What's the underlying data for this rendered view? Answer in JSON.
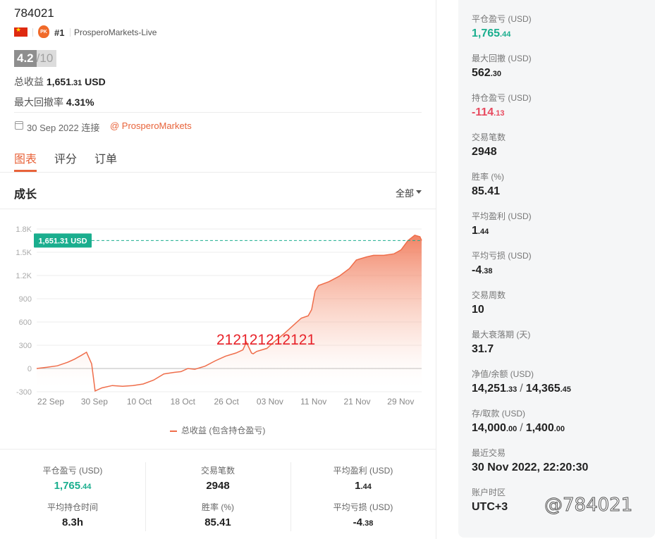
{
  "header": {
    "account_id": "784021",
    "rank": "#1",
    "broker": "ProsperoMarkets-Live",
    "badge_text": "PK",
    "score": "4.2",
    "score_max": "/10",
    "total_profit_label": "总收益",
    "total_profit_int": "1,651",
    "total_profit_dec": ".31",
    "total_profit_ccy": "USD",
    "max_drawdown_label": "最大回撤率",
    "max_drawdown_value": "4.31%",
    "joined_text": "30 Sep 2022 连接",
    "broker_link": "@ ProsperoMarkets"
  },
  "tabs": [
    {
      "label": "图表",
      "active": true
    },
    {
      "label": "评分",
      "active": false
    },
    {
      "label": "订单",
      "active": false
    }
  ],
  "growth": {
    "title": "成长",
    "range_label": "全部",
    "legend_label": "总收益 (包含持仓盈亏)",
    "overlay_text": "212121212121",
    "current_value_label": "1,651.31 USD"
  },
  "chart_data": {
    "type": "area",
    "title": "",
    "xlabel": "",
    "ylabel": "",
    "ylim": [
      -300,
      1800
    ],
    "yticks": [
      -300,
      0,
      300,
      600,
      900,
      1200,
      1500,
      1800
    ],
    "ytick_labels": [
      "-300",
      "0",
      "300",
      "600",
      "900",
      "1.2K",
      "1.5K",
      "1.8K"
    ],
    "x_tick_labels": [
      "22 Sep",
      "30 Sep",
      "10 Oct",
      "18 Oct",
      "26 Oct",
      "03 Nov",
      "11 Nov",
      "21 Nov",
      "29 Nov"
    ],
    "x_tick_pos": [
      0.115,
      0.215,
      0.318,
      0.418,
      0.518,
      0.618,
      0.718,
      0.818,
      0.918
    ],
    "series": [
      {
        "name": "",
        "color": "#ef6d4a",
        "points": [
          [
            0.0,
            0
          ],
          [
            0.03,
            15
          ],
          [
            0.06,
            35
          ],
          [
            0.09,
            80
          ],
          [
            0.11,
            120
          ],
          [
            0.13,
            170
          ],
          [
            0.145,
            210
          ],
          [
            0.16,
            60
          ],
          [
            0.17,
            -290
          ],
          [
            0.19,
            -250
          ],
          [
            0.22,
            -220
          ],
          [
            0.25,
            -230
          ],
          [
            0.28,
            -220
          ],
          [
            0.31,
            -200
          ],
          [
            0.34,
            -150
          ],
          [
            0.37,
            -70
          ],
          [
            0.4,
            -50
          ],
          [
            0.42,
            -40
          ],
          [
            0.44,
            0
          ],
          [
            0.46,
            -10
          ],
          [
            0.49,
            30
          ],
          [
            0.52,
            100
          ],
          [
            0.55,
            160
          ],
          [
            0.58,
            200
          ],
          [
            0.6,
            240
          ],
          [
            0.61,
            340
          ],
          [
            0.625,
            200
          ],
          [
            0.63,
            190
          ],
          [
            0.64,
            220
          ],
          [
            0.67,
            260
          ],
          [
            0.69,
            340
          ],
          [
            0.72,
            450
          ],
          [
            0.75,
            570
          ],
          [
            0.77,
            650
          ],
          [
            0.79,
            680
          ],
          [
            0.8,
            760
          ],
          [
            0.81,
            1000
          ],
          [
            0.82,
            1070
          ],
          [
            0.85,
            1120
          ],
          [
            0.88,
            1190
          ],
          [
            0.91,
            1290
          ],
          [
            0.93,
            1400
          ],
          [
            0.96,
            1440
          ],
          [
            0.98,
            1460
          ],
          [
            1.01,
            1460
          ],
          [
            1.04,
            1480
          ],
          [
            1.06,
            1530
          ],
          [
            1.08,
            1650
          ],
          [
            1.1,
            1720
          ],
          [
            1.115,
            1700
          ],
          [
            1.12,
            1651
          ]
        ]
      }
    ],
    "current_value": 1651.31,
    "grid": true,
    "legend_position": "bottom-center"
  },
  "bottom_stats": [
    {
      "label": "平仓盈亏 (USD)",
      "int": "1,765",
      "dec": ".44",
      "color": "green"
    },
    {
      "label": "交易笔数",
      "int": "2948",
      "dec": "",
      "color": ""
    },
    {
      "label": "平均盈利 (USD)",
      "int": "1",
      "dec": ".44",
      "color": ""
    },
    {
      "label": "平均持仓时间",
      "int": "8.3h",
      "dec": "",
      "color": ""
    },
    {
      "label": "胜率 (%)",
      "int": "85.41",
      "dec": "",
      "color": ""
    },
    {
      "label": "平均亏损 (USD)",
      "int": "-4",
      "dec": ".38",
      "color": ""
    }
  ],
  "right_panel": [
    {
      "label": "平仓盈亏 (USD)",
      "int": "1,765",
      "dec": ".44",
      "color": "green"
    },
    {
      "label": "最大回撤 (USD)",
      "int": "562",
      "dec": ".30",
      "color": ""
    },
    {
      "label": "持仓盈亏 (USD)",
      "int": "-114",
      "dec": ".13",
      "color": "red"
    },
    {
      "label": "交易笔数",
      "int": "2948",
      "dec": "",
      "color": ""
    },
    {
      "label": "胜率 (%)",
      "int": "85.41",
      "dec": "",
      "color": ""
    },
    {
      "label": "平均盈利 (USD)",
      "int": "1",
      "dec": ".44",
      "color": ""
    },
    {
      "label": "平均亏损 (USD)",
      "int": "-4",
      "dec": ".38",
      "color": ""
    },
    {
      "label": "交易周数",
      "int": "10",
      "dec": "",
      "color": ""
    },
    {
      "label": "最大衰落期 (天)",
      "int": "31.7",
      "dec": "",
      "color": ""
    },
    {
      "label": "净值/余额 (USD)",
      "int": "14,251",
      "dec": ".33",
      "int2": "14,365",
      "dec2": ".45",
      "color": ""
    },
    {
      "label": "存/取款 (USD)",
      "int": "14,000",
      "dec": ".00",
      "int2": "1,400",
      "dec2": ".00",
      "color": ""
    },
    {
      "label": "最近交易",
      "int": "30 Nov 2022, 22:20:30",
      "dec": "",
      "color": ""
    },
    {
      "label": "账户时区",
      "int": "UTC+3",
      "dec": "",
      "color": ""
    }
  ],
  "watermark": "@784021"
}
